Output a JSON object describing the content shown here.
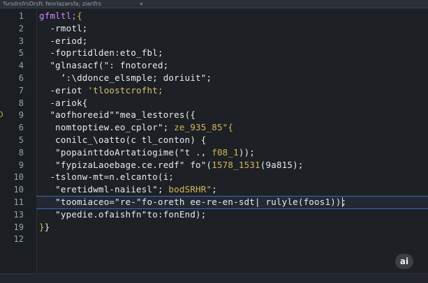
{
  "window": {
    "title": "%rsdrsfrsDrsfc feorlazarsfa; ziarifrs",
    "close_glyph": "×"
  },
  "editor": {
    "fold_glyph": "D",
    "lines": [
      {
        "num": "1",
        "tokens": [
          {
            "t": "gfmltl;",
            "c": "kw"
          },
          {
            "t": "{",
            "c": "gold"
          }
        ]
      },
      {
        "num": "2",
        "tokens": [
          {
            "t": "  -rmotl;",
            "c": "def"
          }
        ]
      },
      {
        "num": "3",
        "tokens": [
          {
            "t": "  -eriod;",
            "c": "def"
          }
        ]
      },
      {
        "num": "5",
        "tokens": [
          {
            "t": "  -foprtidlden:eto_fbl;",
            "c": "def"
          }
        ]
      },
      {
        "num": "4",
        "tokens": [
          {
            "t": "  \"glnasacf(\": fnotored;",
            "c": "def"
          }
        ]
      },
      {
        "num": "6",
        "tokens": [
          {
            "t": "    ’:\\ddonce_elsmple; doriuit\";",
            "c": "def"
          }
        ]
      },
      {
        "num": "7",
        "tokens": [
          {
            "t": "  -eriot ",
            "c": "def"
          },
          {
            "t": "'tloostcrofht;",
            "c": "str"
          }
        ]
      },
      {
        "num": "8",
        "tokens": [
          {
            "t": "  -ariok{",
            "c": "def"
          }
        ]
      },
      {
        "num": "9",
        "tokens": [
          {
            "t": "  \"aofhoreeid\"\"mea_lestores({",
            "c": "def"
          }
        ]
      },
      {
        "num": "6",
        "tokens": [
          {
            "t": "   nomtoptiew.eo_cplor\"; ",
            "c": "def"
          },
          {
            "t": "ze_935_85\"{",
            "c": "gold"
          }
        ]
      },
      {
        "num": "5",
        "tokens": [
          {
            "t": "   conilc_\\oatto(c tl_conton) {",
            "c": "def"
          }
        ]
      },
      {
        "num": "8",
        "tokens": [
          {
            "t": "   \"popainttdoArtatiogime(\"t ., ",
            "c": "def"
          },
          {
            "t": "f08_1",
            "c": "gold"
          },
          {
            "t": "));",
            "c": "def"
          }
        ]
      },
      {
        "num": "9",
        "tokens": [
          {
            "t": "   \"fypizaLaoebage.ce.redf\" fo\"(",
            "c": "def"
          },
          {
            "t": "1578_1531",
            "c": "gold"
          },
          {
            "t": "(9a815);",
            "c": "def"
          }
        ]
      },
      {
        "num": "10",
        "tokens": [
          {
            "t": "  -tslonw-mt=n.elcanto(i;",
            "c": "def"
          }
        ]
      },
      {
        "num": "10",
        "tokens": [
          {
            "t": "   \"eretidwml-naiiesl\"; ",
            "c": "def"
          },
          {
            "t": "bodSRHR\"",
            "c": "gold"
          },
          {
            "t": ";",
            "c": "def"
          }
        ]
      },
      {
        "num": "11",
        "tokens": [
          {
            "t": "   \"toomiaceo=\"re-\"fo-oreth ee-re-en-sdt| ",
            "c": "def"
          },
          {
            "t": "rulyle(foos1));",
            "c": "def"
          }
        ]
      },
      {
        "num": "13",
        "tokens": [
          {
            "t": "   \"ypedie.ofaishfn\"to:fonEnd);",
            "c": "def"
          }
        ]
      },
      {
        "num": "19",
        "tokens": [
          {
            "t": "}",
            "c": "gold"
          },
          {
            "t": "}",
            "c": "def"
          }
        ]
      },
      {
        "num": "12",
        "tokens": []
      }
    ]
  },
  "badge": {
    "label": "ai"
  },
  "colors": {
    "keyword": "#c98bff",
    "string": "#d7c46a",
    "default": "#e9ecef",
    "highlight_border": "#3b6bb5"
  },
  "icons": [
    "close-icon",
    "fold-marker-icon"
  ]
}
